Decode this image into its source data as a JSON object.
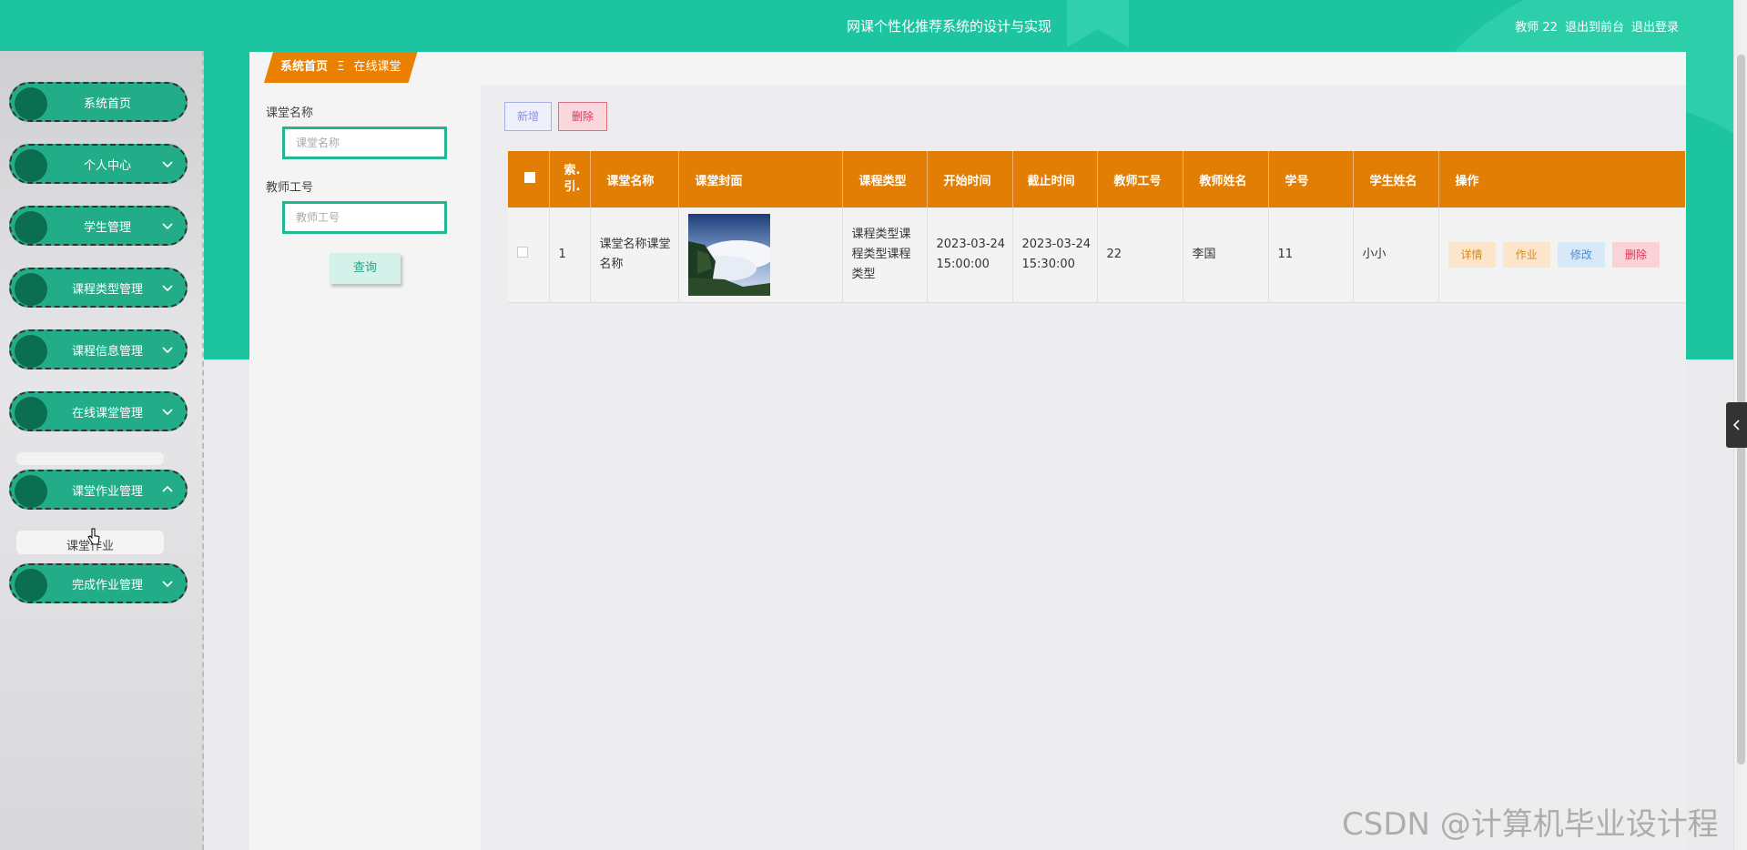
{
  "header": {
    "title": "网课个性化推荐系统的设计与实现",
    "user": "教师 22",
    "back_front": "退出到前台",
    "logout": "退出登录"
  },
  "sidebar": {
    "items": [
      {
        "label": "系统首页",
        "has_chevron": false
      },
      {
        "label": "个人中心",
        "has_chevron": true
      },
      {
        "label": "学生管理",
        "has_chevron": true
      },
      {
        "label": "课程类型管理",
        "has_chevron": true
      },
      {
        "label": "课程信息管理",
        "has_chevron": true
      },
      {
        "label": "在线课堂管理",
        "has_chevron": true
      },
      {
        "label": "课堂作业管理",
        "has_chevron": true,
        "expanded": true
      },
      {
        "label": "完成作业管理",
        "has_chevron": true
      }
    ],
    "submenu_item": "课堂作业"
  },
  "breadcrumb": {
    "home": "系统首页",
    "separator": "Ξ",
    "current": "在线课堂"
  },
  "search": {
    "course_label": "课堂名称",
    "course_placeholder": "课堂名称",
    "teacher_label": "教师工号",
    "teacher_placeholder": "教师工号",
    "query_button": "查询"
  },
  "toolbar": {
    "add_label": "新增",
    "delete_label": "删除"
  },
  "table": {
    "headers": [
      "索引",
      "课堂名称",
      "课堂封面",
      "课程类型",
      "开始时间",
      "截止时间",
      "教师工号",
      "教师姓名",
      "学号",
      "学生姓名",
      "操作"
    ],
    "index_header_line1": "索.",
    "index_header_line2": "引.",
    "rows": [
      {
        "index": "1",
        "course_name": "课堂名称课堂名称",
        "course_type": "课程类型课程类型课程类型",
        "start_date": "2023-03-24",
        "start_time": "15:00:00",
        "end_date": "2023-03-24",
        "end_time": "15:30:00",
        "teacher_id": "22",
        "teacher_name": "李国",
        "student_id": "11",
        "student_name": "小小"
      }
    ],
    "actions": {
      "detail": "详情",
      "homework": "作业",
      "edit": "修改",
      "delete": "删除"
    }
  },
  "watermark": "CSDN @计算机毕业设计程",
  "colors": {
    "teal": "#1cc5a0",
    "orange": "#e27e03",
    "menu_green": "#22ad88"
  }
}
